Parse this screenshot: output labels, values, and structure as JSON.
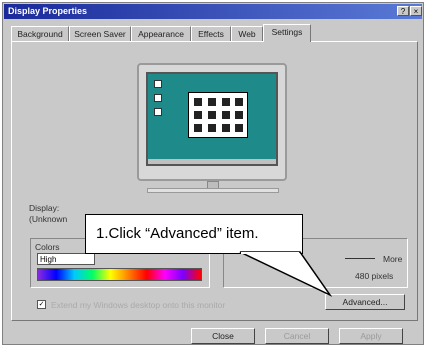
{
  "window": {
    "title": "Display Properties",
    "help_glyph": "?",
    "close_glyph": "×"
  },
  "tabs": [
    {
      "label": "Background"
    },
    {
      "label": "Screen Saver"
    },
    {
      "label": "Appearance"
    },
    {
      "label": "Effects"
    },
    {
      "label": "Web"
    },
    {
      "label": "Settings",
      "active": true
    }
  ],
  "display_label": "Display:",
  "display_value": "(Unknown",
  "colors_group": {
    "label": "Colors",
    "value": "High"
  },
  "screen_area": {
    "more_label": "More",
    "value": "480 pixels"
  },
  "callout": {
    "text": "1.Click “Advanced” item."
  },
  "checkbox": {
    "checked_glyph": "✓",
    "label": "Extend my Windows desktop onto this monitor"
  },
  "advanced_button": "Advanced...",
  "buttons": {
    "close": "Close",
    "cancel": "Cancel",
    "apply": "Apply"
  },
  "colors": {
    "title_bar": "#1a2a9a",
    "desktop": "#1f8a8a"
  }
}
